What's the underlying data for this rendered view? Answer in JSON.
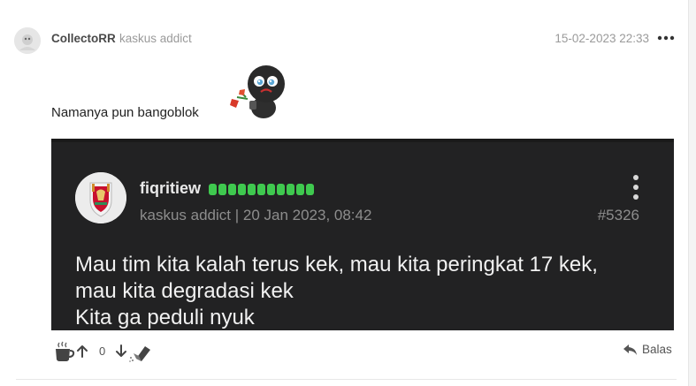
{
  "header": {
    "username": "CollectoRR",
    "rank": "kaskus addict",
    "timestamp": "15-02-2023 22:33"
  },
  "post": {
    "text": "Namanya pun bangoblok"
  },
  "quote": {
    "username": "fiqritiew",
    "reputation_bars": 11,
    "meta": "kaskus addict | 20 Jan 2023, 08:42",
    "post_number": "#5326",
    "lines": [
      "Mau tim kita kalah terus kek, mau kita peringkat 17 kek,",
      "mau kita degradasi kek",
      "Kita ga peduli nyuk"
    ],
    "bar_color": "#3fc94f"
  },
  "footer": {
    "vote_count": "0",
    "reply_label": "Balas"
  },
  "icons": {
    "more": "more-horizontal-icon",
    "kebab": "more-vertical-icon",
    "coffee": "coffee-cup-icon",
    "upvote": "arrow-up-icon",
    "downvote": "arrow-down-icon",
    "eraser": "eraser-icon",
    "reply": "reply-icon"
  }
}
